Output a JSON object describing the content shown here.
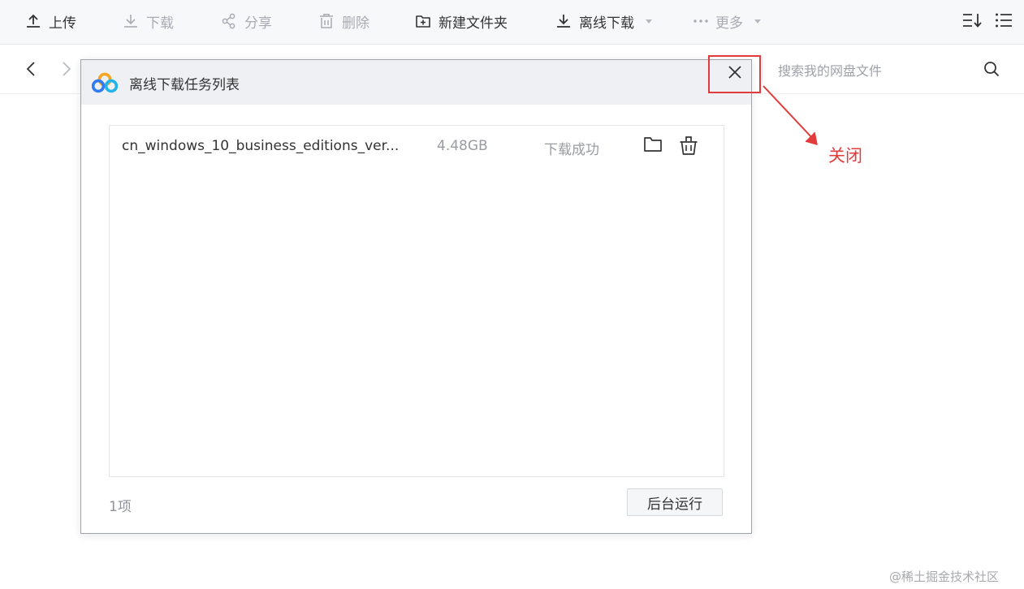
{
  "toolbar": {
    "upload_label": "上传",
    "download_label": "下载",
    "share_label": "分享",
    "delete_label": "删除",
    "new_folder_label": "新建文件夹",
    "offline_download_label": "离线下载",
    "more_label": "更多"
  },
  "search": {
    "placeholder": "搜索我的网盘文件"
  },
  "dialog": {
    "title": "离线下载任务列表",
    "tasks": [
      {
        "name": "cn_windows_10_business_editions_ver...",
        "size": "4.48GB",
        "status": "下载成功"
      }
    ],
    "count": "1项",
    "background_button_label": "后台运行"
  },
  "annotation": {
    "label": "关闭",
    "color": "#e23b3b"
  },
  "watermark": "@稀土掘金技术社区",
  "icons": {
    "upload": "upload-icon",
    "download": "download-icon",
    "share": "share-icon",
    "delete": "trash-icon",
    "new_folder": "new-folder-icon",
    "offline_download": "offline-download-icon",
    "more": "more-dots-icon",
    "sort": "sort-icon",
    "list_view": "list-view-icon",
    "back": "chevron-left-icon",
    "forward": "chevron-right-icon",
    "search": "search-icon",
    "logo": "baidu-netdisk-logo-icon",
    "close": "close-icon",
    "open_folder": "folder-icon",
    "remove_task": "basket-delete-icon"
  }
}
